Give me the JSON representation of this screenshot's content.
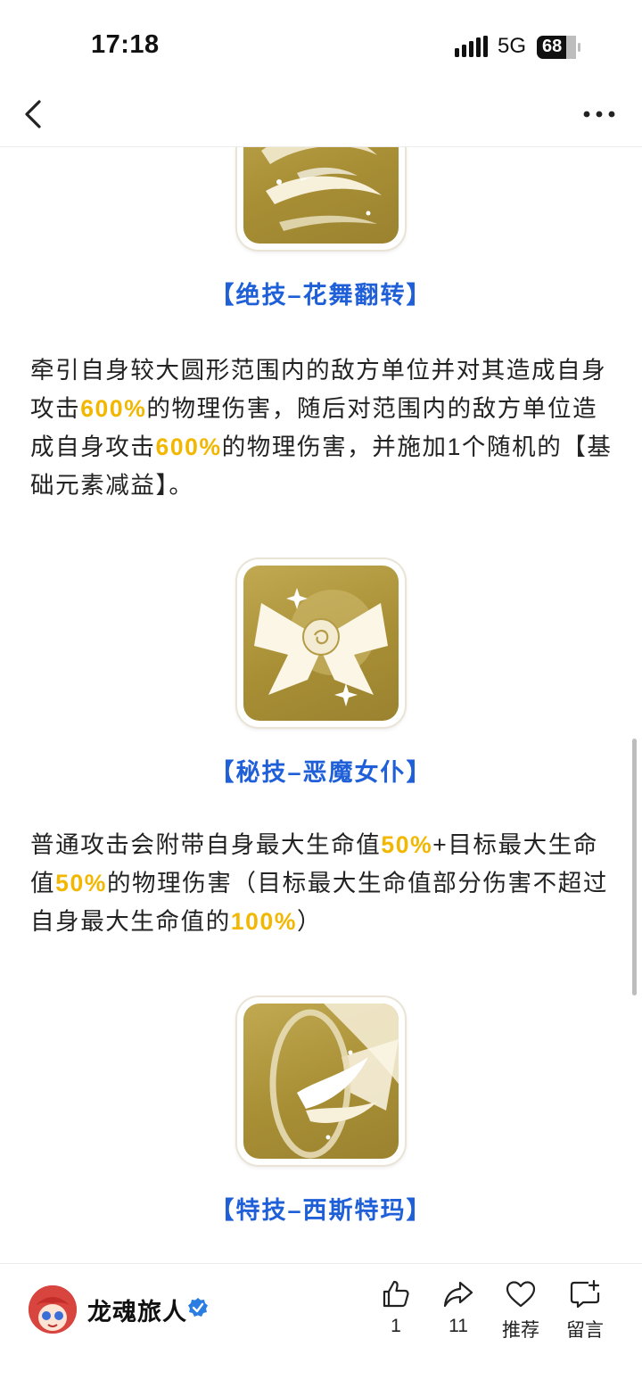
{
  "status_bar": {
    "time": "17:18",
    "network": "5G",
    "battery": "68"
  },
  "article": {
    "skills": [
      {
        "title": "【绝技–花舞翻转】",
        "icon": "whirl-flower-icon"
      },
      {
        "title": "【秘技–恶魔女仆】",
        "icon": "bow-rose-icon"
      },
      {
        "title": "【特技–西斯特玛】",
        "icon": "ring-wing-icon"
      }
    ],
    "desc1": {
      "t1": "牵引自身较大圆形范围内的敌方单位并对其造成自身攻击",
      "h1": "600%",
      "t2": "的物理伤害，随后对范围内的敌方单位造成自身攻击",
      "h2": "600%",
      "t3": "的物理伤害，并施加1个随机的【基础元素减益】。"
    },
    "desc2": {
      "t1": "普通攻击会附带自身最大生命值",
      "h1": "50%",
      "t2": "+目标最大生命值",
      "h2": "50%",
      "t3": "的物理伤害（目标最大生命值部分伤害不超过自身最大生命值的",
      "h3": "100%",
      "t4": "）"
    }
  },
  "footer": {
    "author": "龙魂旅人",
    "actions": [
      {
        "icon": "thumbs-up-icon",
        "label": "1"
      },
      {
        "icon": "share-icon",
        "label": "11"
      },
      {
        "icon": "heart-icon",
        "label": "推荐"
      },
      {
        "icon": "comment-icon",
        "label": "留言"
      }
    ]
  },
  "colors": {
    "accent_blue": "#1f5fd8",
    "highlight_yellow": "#f2b700",
    "icon_gold": "#a88f35"
  }
}
